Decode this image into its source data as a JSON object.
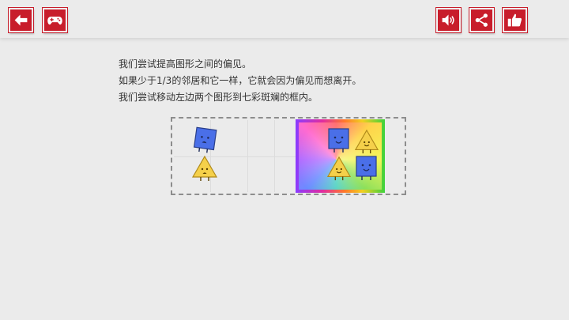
{
  "toolbar": {
    "back_icon": "back-arrow-icon",
    "gamepad_icon": "gamepad-icon",
    "sound_icon": "speaker-sound-icon",
    "share_icon": "share-icon",
    "like_icon": "thumbs-up-icon"
  },
  "instructions": {
    "line1": "我们尝试提高图形之间的偏见。",
    "line2": "如果少于1/3的邻居和它一样，它就会因为偏见而想离开。",
    "line3": "我们尝试移动左边两个图形到七彩斑斓的框内。"
  },
  "colors": {
    "accent_red": "#c81d2b",
    "square_blue": "#4a6fe8",
    "triangle_yellow": "#f5d04a"
  },
  "board": {
    "left_shapes": [
      "sad-square",
      "sad-triangle"
    ],
    "rainbow_shapes": [
      "happy-square",
      "happy-triangle",
      "happy-triangle",
      "happy-square"
    ]
  }
}
